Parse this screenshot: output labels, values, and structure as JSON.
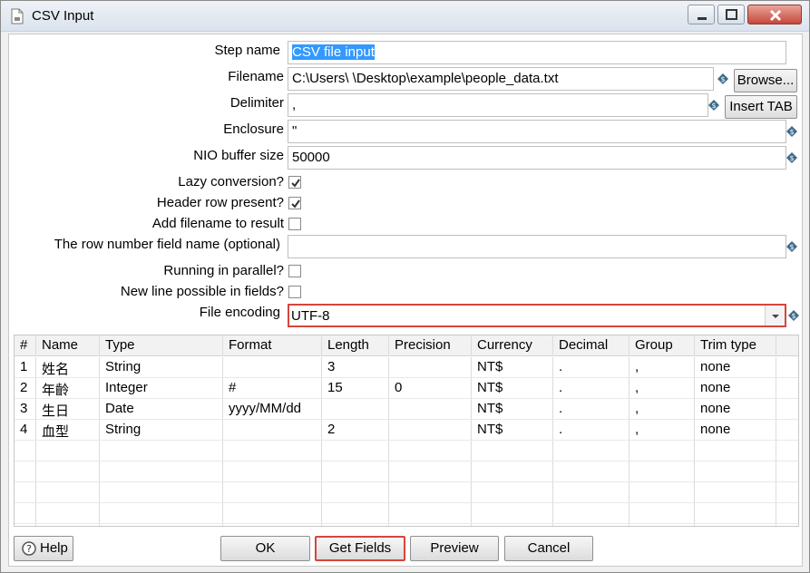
{
  "window": {
    "title": "CSV Input"
  },
  "form": {
    "step_name_label": "Step name",
    "step_name_value": "CSV file input",
    "filename_label": "Filename",
    "filename_value": "C:\\Users\\            \\Desktop\\example\\people_data.txt",
    "browse_label": "Browse...",
    "delimiter_label": "Delimiter",
    "delimiter_value": ",",
    "insert_tab_label": "Insert TAB",
    "enclosure_label": "Enclosure",
    "enclosure_value": "\"",
    "nio_label": "NIO buffer size",
    "nio_value": "50000",
    "lazy_label": "Lazy conversion?",
    "lazy_checked": true,
    "header_label": "Header row present?",
    "header_checked": true,
    "add_filename_label": "Add filename to result",
    "add_filename_checked": false,
    "rownum_label": "The row number field name (optional)",
    "rownum_value": "",
    "parallel_label": "Running in parallel?",
    "parallel_checked": false,
    "newline_label": "New line possible in fields?",
    "newline_checked": false,
    "encoding_label": "File encoding",
    "encoding_value": "UTF-8"
  },
  "grid": {
    "columns": [
      "#",
      "Name",
      "Type",
      "Format",
      "Length",
      "Precision",
      "Currency",
      "Decimal",
      "Group",
      "Trim type"
    ],
    "rows": [
      [
        "1",
        "姓名",
        "String",
        "",
        "3",
        "",
        "NT$",
        ".",
        ",",
        "none"
      ],
      [
        "2",
        "年齡",
        "Integer",
        "#",
        "15",
        "0",
        "NT$",
        ".",
        ",",
        "none"
      ],
      [
        "3",
        "生日",
        "Date",
        "yyyy/MM/dd",
        "",
        "",
        "NT$",
        ".",
        ",",
        "none"
      ],
      [
        "4",
        "血型",
        "String",
        "",
        "2",
        "",
        "NT$",
        ".",
        ",",
        "none"
      ]
    ]
  },
  "buttons": {
    "help": "Help",
    "ok": "OK",
    "get_fields": "Get Fields",
    "preview": "Preview",
    "cancel": "Cancel"
  },
  "colors": {
    "highlight_border": "#d8443c",
    "selection": "#3399ff"
  }
}
